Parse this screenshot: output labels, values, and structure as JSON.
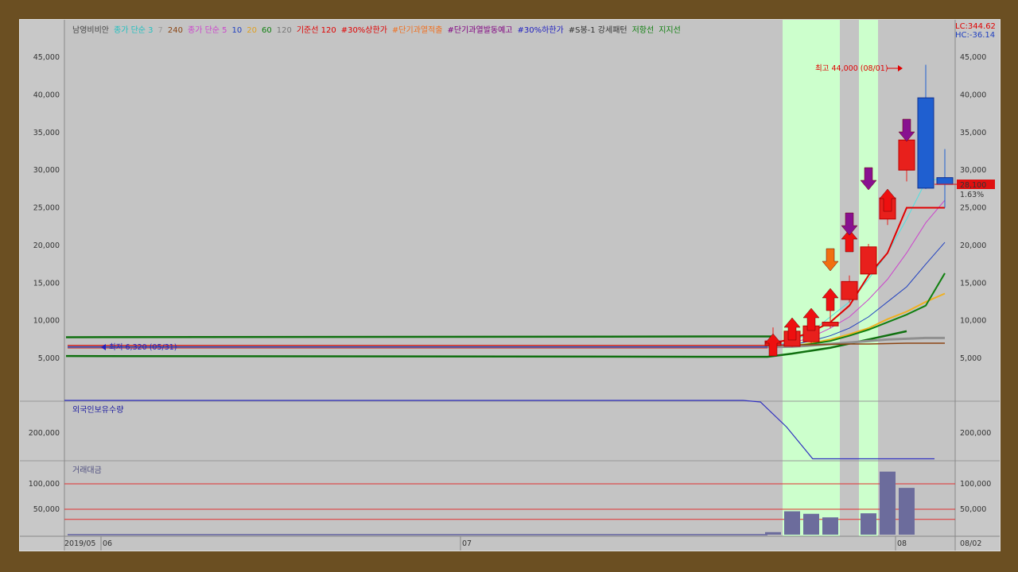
{
  "colors": {
    "up": "#e8201c",
    "down": "#1f5fd0",
    "highlight": "#ccffcc",
    "ma3": "#50e0e0",
    "ma5": "#cc44cc",
    "ma10": "#2040c0",
    "ma20": "#f0b020",
    "ma60": "#108010",
    "ma120": "#909090",
    "base120": "#e00000",
    "resistance": "#107010",
    "support": "#107010"
  },
  "legend": {
    "items": [
      {
        "text": "남영비비안",
        "color": "#444"
      },
      {
        "text": "종가 단순 3",
        "color": "#20c0c0"
      },
      {
        "text": "7",
        "color": "#999"
      },
      {
        "text": "240",
        "color": "#8b4513"
      },
      {
        "text": "종가 단순 5",
        "color": "#cc44cc"
      },
      {
        "text": "10",
        "color": "#2040c0"
      },
      {
        "text": "20",
        "color": "#e0a020"
      },
      {
        "text": "60",
        "color": "#108010"
      },
      {
        "text": "120",
        "color": "#777"
      },
      {
        "text": "기준선 120",
        "color": "#e00000"
      },
      {
        "text": "#30%상한가",
        "color": "#e00000"
      },
      {
        "text": "#단기과열적출",
        "color": "#f07020"
      },
      {
        "text": "#단기과열발동예고",
        "color": "#800080"
      },
      {
        "text": "#30%하한가",
        "color": "#2020c0"
      },
      {
        "text": "#S봉-1 강세패턴",
        "color": "#333"
      },
      {
        "text": "저항선",
        "color": "#108010"
      },
      {
        "text": "지지선",
        "color": "#108010"
      }
    ],
    "lc": "LC:344.62",
    "hc": "HC:-36.14"
  },
  "chart_data": [
    {
      "type": "candlestick",
      "title": "남영비비안",
      "ylim": [
        0,
        48000
      ],
      "y_ticks": [
        5000,
        10000,
        15000,
        20000,
        25000,
        30000,
        35000,
        40000,
        45000
      ],
      "y_tick_labels": [
        "5,000",
        "10,000",
        "15,000",
        "20,000",
        "25,000",
        "30,000",
        "35,000",
        "40,000",
        "45,000"
      ],
      "current_price": "28,100",
      "current_change": "1.63%",
      "annotations": {
        "high": "최고 44,000 (08/01)",
        "low": "최저 6,320 (05/31)"
      },
      "candles": [
        {
          "o": 6700,
          "c": 7300,
          "h": 9100,
          "l": 6700
        },
        {
          "o": 6600,
          "c": 8600,
          "h": 9000,
          "l": 6500
        },
        {
          "o": 7200,
          "c": 9300,
          "h": 11600,
          "l": 7000
        },
        {
          "o": 9300,
          "c": 9800,
          "h": 11800,
          "l": 9000
        },
        {
          "o": 12800,
          "c": 15200,
          "h": 16000,
          "l": 12400
        },
        {
          "o": 16200,
          "c": 19800,
          "h": 20200,
          "l": 15800
        },
        {
          "o": 23500,
          "c": 26300,
          "h": 26500,
          "l": 22700
        },
        {
          "o": 30000,
          "c": 34000,
          "h": 34000,
          "l": 28500
        },
        {
          "o": 39600,
          "c": 27600,
          "h": 44000,
          "l": 27500
        },
        {
          "o": 29000,
          "c": 28100,
          "h": 32800,
          "l": 25000
        }
      ]
    },
    {
      "type": "line",
      "title": "외국인보유수량",
      "y_ticks": [
        200000
      ],
      "y_tick_labels": [
        "200,000"
      ],
      "series": [
        {
          "name": "외국인보유수량",
          "x": [
            0,
            0.78,
            0.8,
            0.83,
            0.86,
            0.9,
            1.0
          ],
          "values": [
            282000,
            282000,
            278000,
            215000,
            135000,
            135000,
            135000
          ]
        }
      ]
    },
    {
      "type": "bar",
      "title": "거래대금",
      "ylim": [
        0,
        120000
      ],
      "y_ticks": [
        50000,
        100000
      ],
      "y_tick_labels": [
        "50,000",
        "100,000"
      ],
      "ref_lines": [
        100000,
        50000,
        30000
      ],
      "bars": [
        {
          "slot": 0,
          "value": 5000
        },
        {
          "slot": 1,
          "value": 46000
        },
        {
          "slot": 2,
          "value": 41000
        },
        {
          "slot": 3,
          "value": 34000
        },
        {
          "slot": 5,
          "value": 42000
        },
        {
          "slot": 6,
          "value": 124000
        },
        {
          "slot": 7,
          "value": 92000
        }
      ]
    }
  ],
  "x_axis": {
    "labels": [
      "2019/05",
      "06",
      "07",
      "08",
      "08/02"
    ]
  }
}
